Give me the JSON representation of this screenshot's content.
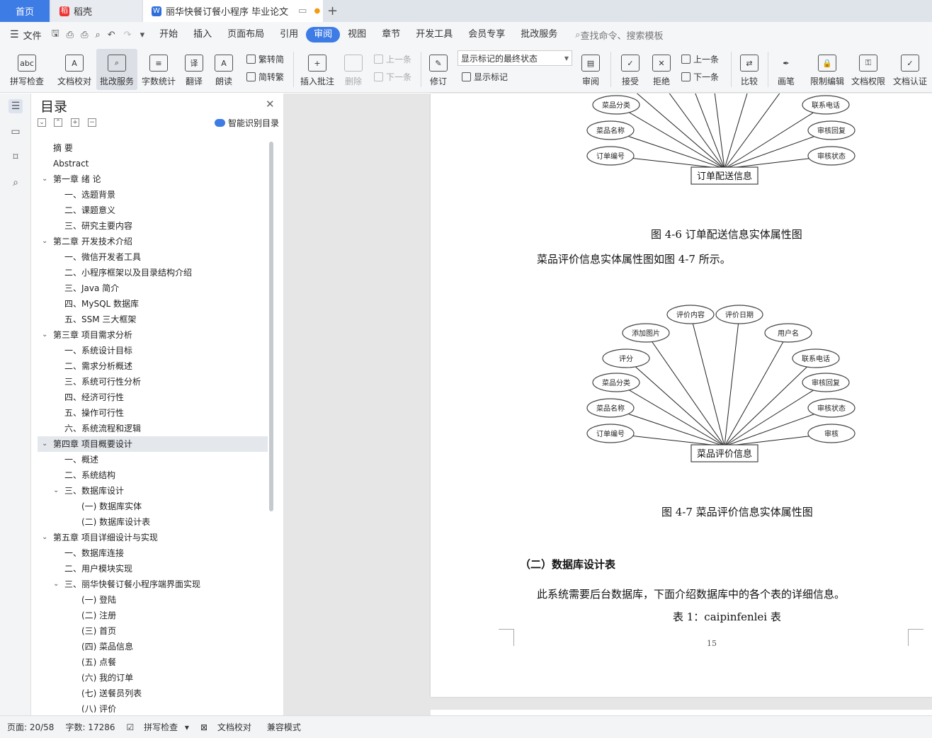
{
  "tabs": {
    "home": "首页",
    "daoke": "稻壳",
    "doc": "丽华快餐订餐小程序 毕业论文"
  },
  "menubar": {
    "file": "文件",
    "items": [
      "开始",
      "插入",
      "页面布局",
      "引用",
      "审阅",
      "视图",
      "章节",
      "开发工具",
      "会员专享",
      "批改服务"
    ],
    "search": "查找命令、搜索模板"
  },
  "ribbon": {
    "spell": "拼写检查",
    "proof": "文档校对",
    "grade": "批改服务",
    "wordcount": "字数统计",
    "translate": "翻译",
    "read": "朗读",
    "trad2simp": "繁转简",
    "simp2trad": "简转繁",
    "insert_comment": "插入批注",
    "delete": "删除",
    "prev": "上一条",
    "next": "下一条",
    "revise": "修订",
    "markup_state": "显示标记的最终状态",
    "show_markup": "显示标记",
    "review": "审阅",
    "accept": "接受",
    "reject": "拒绝",
    "prev2": "上一条",
    "next2": "下一条",
    "compare": "比较",
    "pen": "画笔",
    "restrict": "限制编辑",
    "perm": "文档权限",
    "cert": "文档认证"
  },
  "nav": {
    "title": "目录",
    "smart": "智能识别目录"
  },
  "toc": [
    {
      "t": "摘 要",
      "lvl": 1
    },
    {
      "t": "Abstract",
      "lvl": 1
    },
    {
      "t": "第一章 绪 论",
      "lvl": 0
    },
    {
      "t": "一、选题背景",
      "lvl": 2
    },
    {
      "t": "二、课题意义",
      "lvl": 2
    },
    {
      "t": "三、研究主要内容",
      "lvl": 2
    },
    {
      "t": "第二章 开发技术介绍",
      "lvl": 0
    },
    {
      "t": "一、微信开发者工具",
      "lvl": 2
    },
    {
      "t": "二、小程序框架以及目录结构介绍",
      "lvl": 2
    },
    {
      "t": "三、Java 简介",
      "lvl": 2
    },
    {
      "t": "四、MySQL 数据库",
      "lvl": 2
    },
    {
      "t": "五、SSM 三大框架",
      "lvl": 2
    },
    {
      "t": "第三章 项目需求分析",
      "lvl": 0
    },
    {
      "t": "一、系统设计目标",
      "lvl": 2
    },
    {
      "t": "二、需求分析概述",
      "lvl": 2
    },
    {
      "t": "三、系统可行性分析",
      "lvl": 2
    },
    {
      "t": "四、经济可行性",
      "lvl": 2
    },
    {
      "t": "五、操作可行性",
      "lvl": 2
    },
    {
      "t": "六、系统流程和逻辑",
      "lvl": 2
    },
    {
      "t": "第四章 项目概要设计",
      "lvl": 0,
      "hl": true
    },
    {
      "t": "一、概述",
      "lvl": 2
    },
    {
      "t": "二、系统结构",
      "lvl": 2
    },
    {
      "t": "三、数据库设计",
      "lvl": 3
    },
    {
      "t": "(一) 数据库实体",
      "lvl": 4
    },
    {
      "t": "(二) 数据库设计表",
      "lvl": 4
    },
    {
      "t": "第五章 项目详细设计与实现",
      "lvl": 0
    },
    {
      "t": "一、数据库连接",
      "lvl": 2
    },
    {
      "t": "二、用户模块实现",
      "lvl": 2
    },
    {
      "t": "三、丽华快餐订餐小程序端界面实现",
      "lvl": 3
    },
    {
      "t": "(一) 登陆",
      "lvl": 4
    },
    {
      "t": "(二) 注册",
      "lvl": 4
    },
    {
      "t": "(三) 首页",
      "lvl": 4
    },
    {
      "t": "(四) 菜品信息",
      "lvl": 4
    },
    {
      "t": "(五) 点餐",
      "lvl": 4
    },
    {
      "t": "(六) 我的订单",
      "lvl": 4
    },
    {
      "t": "(七) 送餐员列表",
      "lvl": 4
    },
    {
      "t": "(八) 评价",
      "lvl": 4
    }
  ],
  "doc": {
    "diag1": {
      "center": "订单配送信息",
      "left": [
        "菜品分类",
        "菜品名称",
        "订单编号"
      ],
      "right": [
        "联系电话",
        "审核回复",
        "审核状态"
      ]
    },
    "cap1": "图 4-6 订单配送信息实体属性图",
    "para1": "菜品评价信息实体属性图如图 4-7 所示。",
    "diag2": {
      "center": "菜品评价信息",
      "left": [
        "添加图片",
        "评分",
        "菜品分类",
        "菜品名称",
        "订单编号"
      ],
      "top": [
        "评价内容",
        "评价日期"
      ],
      "right": [
        "用户名",
        "联系电话",
        "审核回复",
        "审核状态",
        "审核"
      ]
    },
    "cap2": "图 4-7 菜品评价信息实体属性图",
    "heading": "（二）数据库设计表",
    "para2": "此系统需要后台数据库，下面介绍数据库中的各个表的详细信息。",
    "tablecap": "表 1：caipinfenlei 表",
    "pagenum": "15"
  },
  "status": {
    "page": "页面: 20/58",
    "words": "字数: 17286",
    "spell": "拼写检查",
    "proof": "文档校对",
    "compat": "兼容模式"
  }
}
